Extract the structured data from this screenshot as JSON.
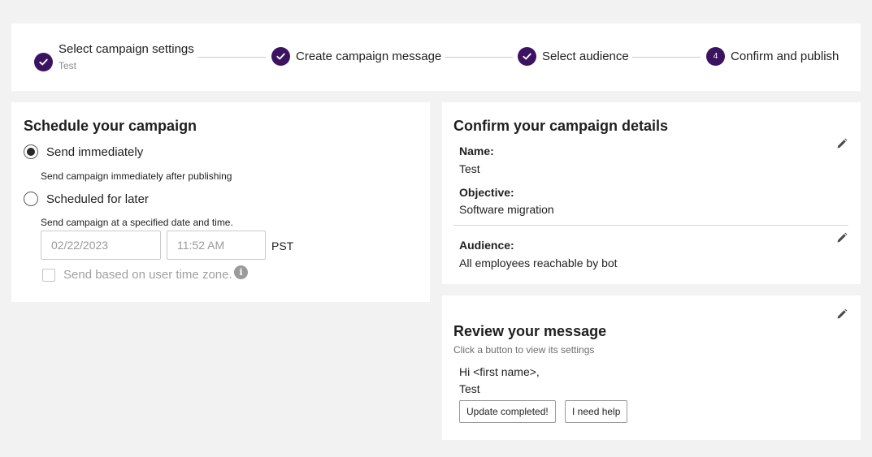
{
  "stepper": {
    "steps": [
      {
        "label": "Select campaign settings",
        "sublabel": "Test",
        "status": "complete"
      },
      {
        "label": "Create campaign message",
        "status": "complete"
      },
      {
        "label": "Select audience",
        "status": "complete"
      },
      {
        "label": "Confirm and publish",
        "number": "4",
        "status": "current"
      }
    ]
  },
  "schedule": {
    "title": "Schedule your campaign",
    "options": [
      {
        "label": "Send immediately",
        "description": "Send campaign immediately after publishing",
        "selected": true
      },
      {
        "label": "Scheduled for later",
        "description": "Send campaign at a specified date and time.",
        "selected": false
      }
    ],
    "date_value": "02/22/2023",
    "time_value": "11:52 AM",
    "timezone": "PST",
    "user_timezone_label": "Send based on user time zone.",
    "user_timezone_checked": false,
    "info_icon": "i"
  },
  "details": {
    "title": "Confirm your campaign details",
    "name_label": "Name:",
    "name_value": "Test",
    "objective_label": "Objective:",
    "objective_value": "Software migration",
    "audience_label": "Audience:",
    "audience_value": "All employees reachable by bot"
  },
  "review": {
    "title": "Review your message",
    "subtitle": "Click a button to view its settings",
    "greeting": "Hi <first name>,",
    "body": "Test",
    "buttons": [
      "Update completed!",
      "I need help"
    ]
  },
  "colors": {
    "accent": "#3c1361",
    "background": "#f2f2f2",
    "card": "#ffffff"
  },
  "icons": {
    "step_complete": "checkmark-icon",
    "edit": "pencil-icon",
    "info": "info-icon"
  }
}
